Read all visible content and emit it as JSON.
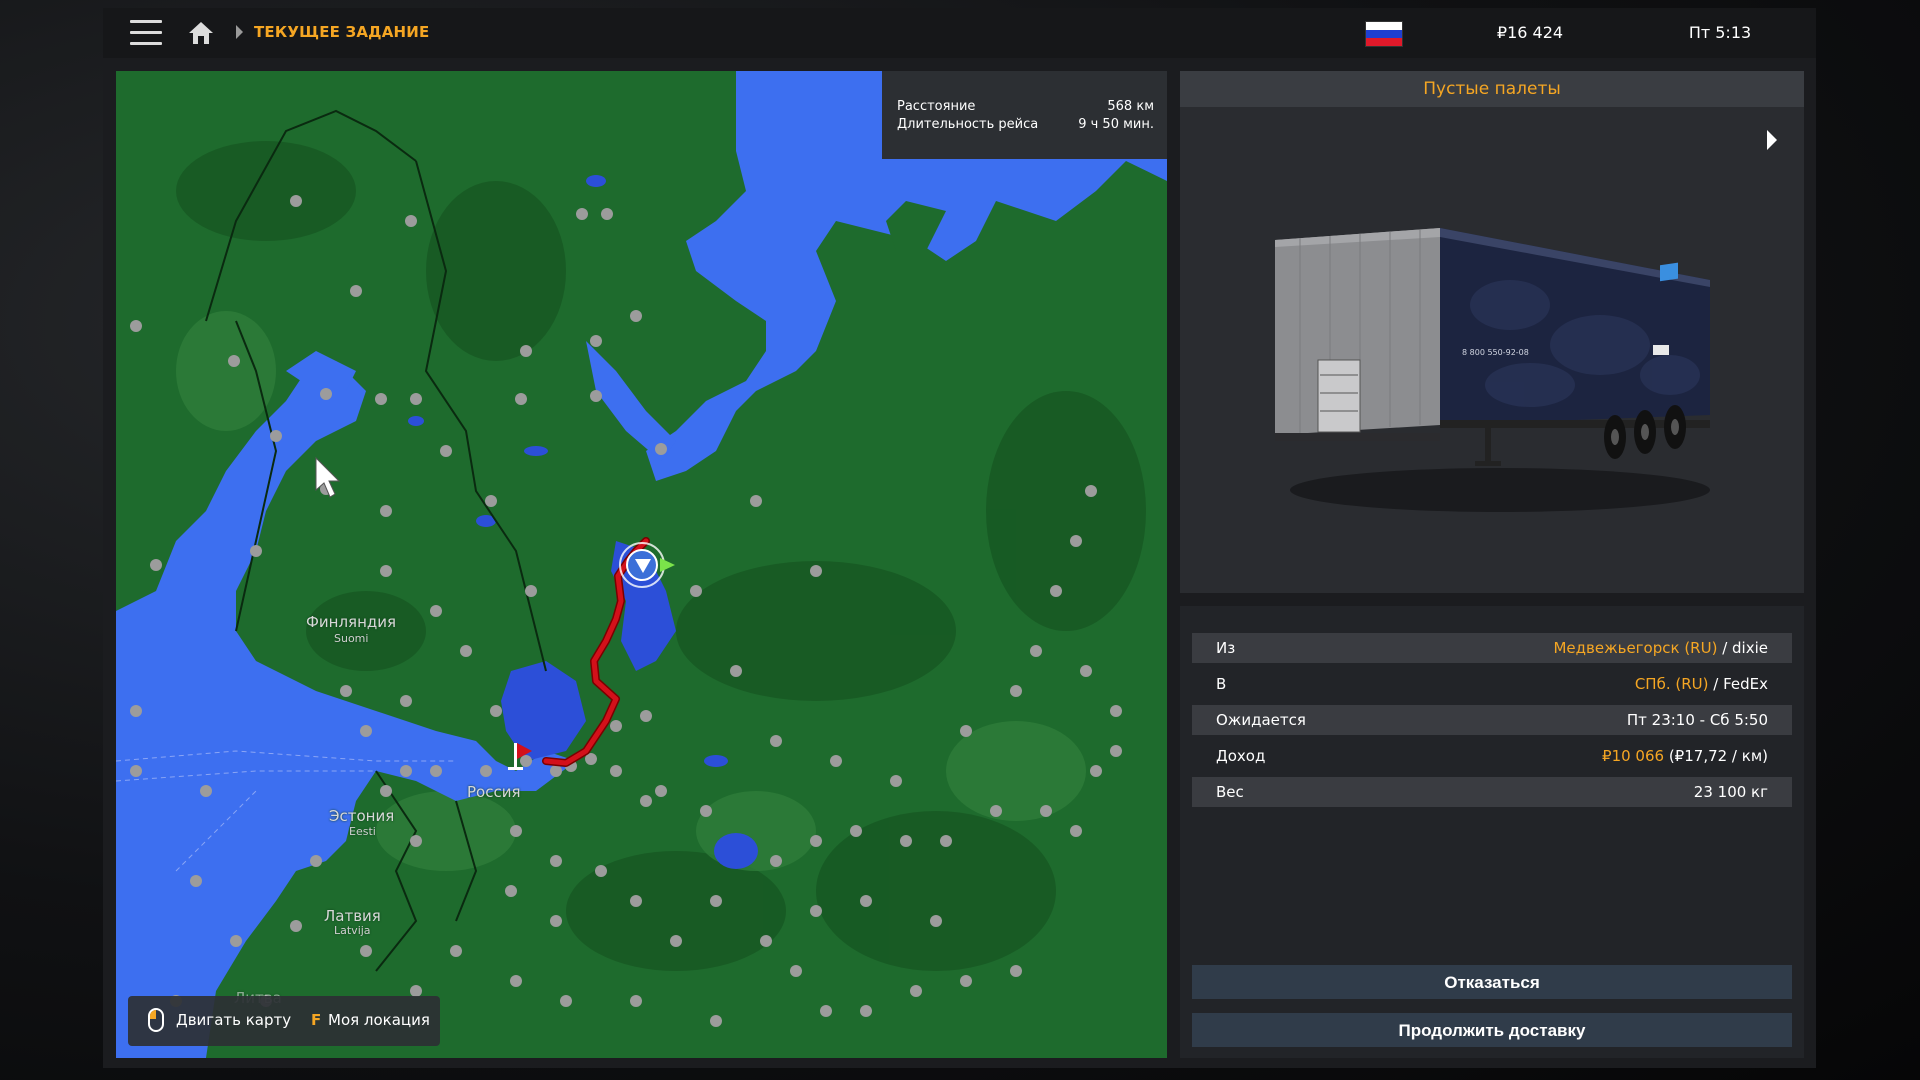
{
  "header": {
    "breadcrumb": "ТЕКУЩЕЕ ЗАДАНИЕ",
    "money": "₽16 424",
    "time": "Пт 5:13",
    "flag_colors": [
      "#ffffff",
      "#1f3fd1",
      "#e0192a"
    ]
  },
  "map": {
    "distance_label": "Расстояние",
    "distance_value": "568 км",
    "duration_label": "Длительность рейса",
    "duration_value": "9 ч 50 мин.",
    "labels": {
      "finland": "Финляндия",
      "finland_local": "Suomi",
      "russia": "Россия",
      "estonia": "Эстония",
      "estonia_local": "Eesti",
      "latvia": "Латвия",
      "latvia_local": "Latvija",
      "lithuania": "Литва"
    },
    "hints": {
      "move_map": "Двигать карту",
      "location_key": "F",
      "location_label": "Моя локация"
    },
    "colors": {
      "land": "#1e6b2d",
      "water": "#3d6ff0",
      "route": "#d3101a"
    }
  },
  "cargo": {
    "title": "Пустые палеты",
    "trailer_text": "8 800 550-92-08"
  },
  "details": {
    "from_label": "Из",
    "from_city": "Медвежьегорск (RU)",
    "from_company": " / dixie",
    "to_label": "В",
    "to_city": "СПб. (RU)",
    "to_company": " / FedEx",
    "expected_label": "Ожидается",
    "expected_value": "Пт 23:10 - Сб 5:50",
    "income_label": "Доход",
    "income_value": "₽10 066",
    "income_rate": " (₽17,72 / км)",
    "weight_label": "Вес",
    "weight_value": "23 100 кг"
  },
  "buttons": {
    "decline": "Отказаться",
    "continue": "Продолжить доставку"
  }
}
